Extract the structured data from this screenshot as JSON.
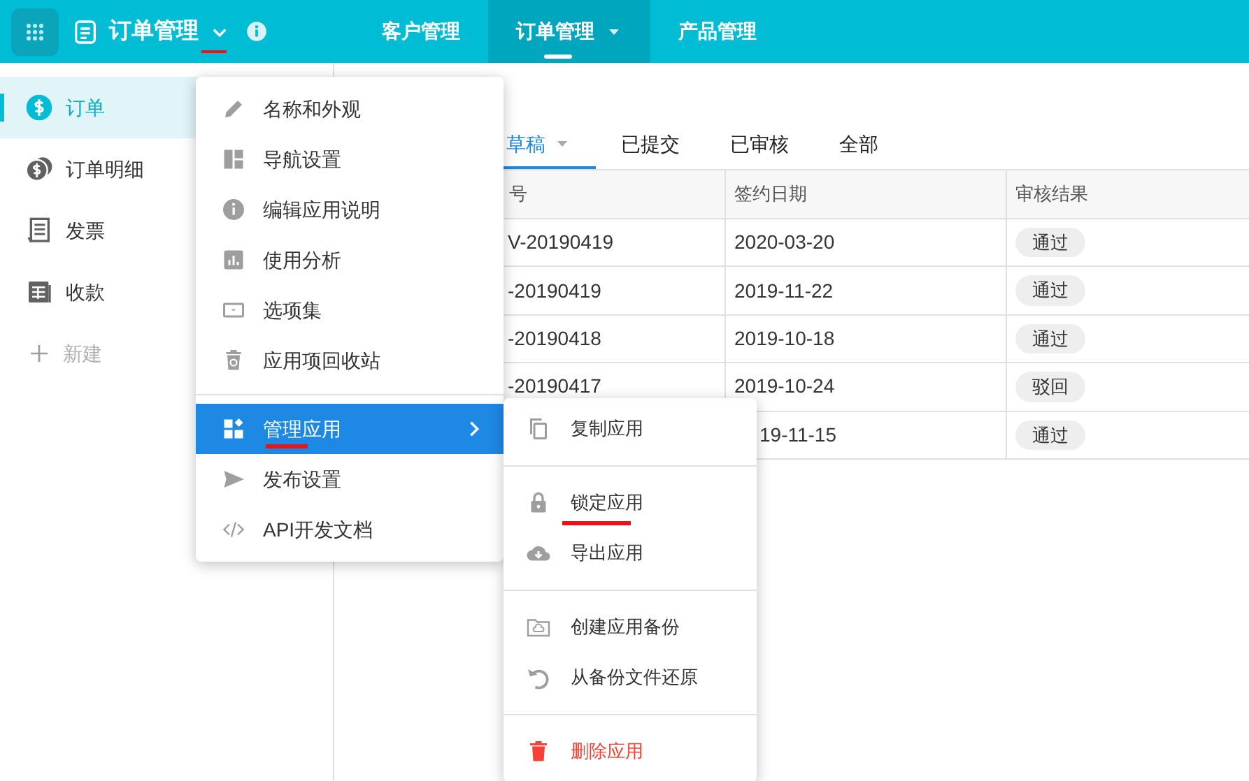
{
  "top_bar": {
    "app_title": "订单管理",
    "title_caret_marked": true,
    "nav": [
      {
        "label": "客户管理",
        "selected": false,
        "dropdown": false
      },
      {
        "label": "订单管理",
        "selected": true,
        "dropdown": true
      },
      {
        "label": "产品管理",
        "selected": false,
        "dropdown": false
      }
    ]
  },
  "sidebar": {
    "items": [
      {
        "label": "订单",
        "selected": true,
        "kind": "page"
      },
      {
        "label": "订单明细",
        "selected": false,
        "kind": "page"
      },
      {
        "label": "发票",
        "selected": false,
        "kind": "page"
      },
      {
        "label": "收款",
        "selected": false,
        "kind": "page"
      },
      {
        "label": "新建",
        "selected": false,
        "kind": "add"
      }
    ]
  },
  "tabs": [
    {
      "label": "草稿",
      "selected": true,
      "dropdown": true
    },
    {
      "label": "已提交",
      "selected": false,
      "dropdown": false
    },
    {
      "label": "已审核",
      "selected": false,
      "dropdown": false
    },
    {
      "label": "全部",
      "selected": false,
      "dropdown": false
    }
  ],
  "table": {
    "columns": [
      "号",
      "签约日期",
      "审核结果"
    ],
    "rows": [
      {
        "cells": [
          "V-20190419",
          "2020-03-20",
          "通过"
        ]
      },
      {
        "cells": [
          "-20190419",
          "2019-11-22",
          "通过"
        ]
      },
      {
        "cells": [
          "-20190418",
          "2019-10-18",
          "通过"
        ]
      },
      {
        "cells": [
          "-20190417",
          "2019-10-24",
          "驳回"
        ]
      },
      {
        "cells": [
          null,
          "19-11-15",
          "通过"
        ],
        "date_partly_covered": true
      }
    ]
  },
  "app_menu": {
    "groups": [
      [
        {
          "label": "名称和外观",
          "selected": false,
          "marked": false
        },
        {
          "label": "导航设置",
          "selected": false,
          "marked": false
        },
        {
          "label": "编辑应用说明",
          "selected": false,
          "marked": false
        },
        {
          "label": "使用分析",
          "selected": false,
          "marked": false
        },
        {
          "label": "选项集",
          "selected": false,
          "marked": false
        },
        {
          "label": "应用项回收站",
          "selected": false,
          "marked": false
        }
      ],
      [
        {
          "label": "管理应用",
          "selected": true,
          "marked": true,
          "submenu": true
        },
        {
          "label": "发布设置",
          "selected": false,
          "marked": false
        },
        {
          "label": "API开发文档",
          "selected": false,
          "marked": false
        }
      ]
    ]
  },
  "sub_menu": {
    "groups": [
      [
        {
          "label": "复制应用",
          "kind": "normal",
          "marked": false
        }
      ],
      [
        {
          "label": "锁定应用",
          "kind": "normal",
          "marked": true
        },
        {
          "label": "导出应用",
          "kind": "normal",
          "marked": false
        }
      ],
      [
        {
          "label": "创建应用备份",
          "kind": "normal",
          "marked": false
        },
        {
          "label": "从备份文件还原",
          "kind": "normal",
          "marked": false
        }
      ],
      [
        {
          "label": "删除应用",
          "kind": "danger",
          "marked": false
        }
      ]
    ]
  }
}
